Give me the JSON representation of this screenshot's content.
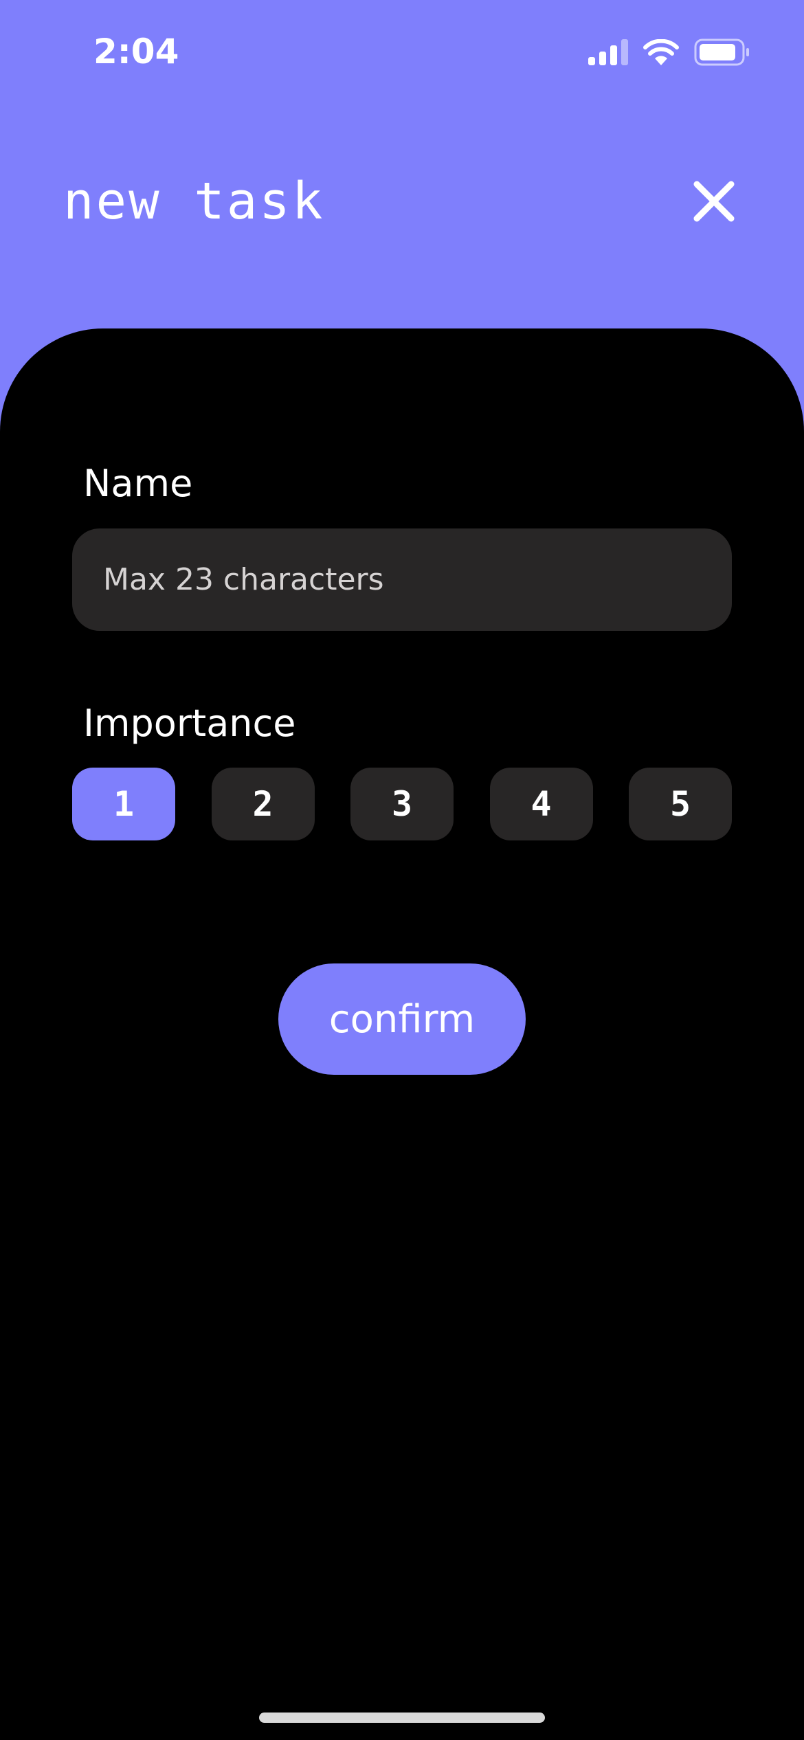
{
  "status_bar": {
    "time": "2:04",
    "icons": [
      "cellular-signal-icon",
      "wifi-icon",
      "battery-icon"
    ]
  },
  "header": {
    "title": "new task",
    "close_icon": "close-icon"
  },
  "form": {
    "name_label": "Name",
    "name_placeholder": "Max 23 characters",
    "name_value": "",
    "importance_label": "Importance",
    "importance_options": [
      "1",
      "2",
      "3",
      "4",
      "5"
    ],
    "importance_selected": "1",
    "confirm_label": "confirm"
  },
  "colors": {
    "accent": "#7f7ffc",
    "sheet_background": "#000000",
    "control_background": "#282626",
    "text": "#ffffff",
    "placeholder": "#d6d3d3"
  }
}
